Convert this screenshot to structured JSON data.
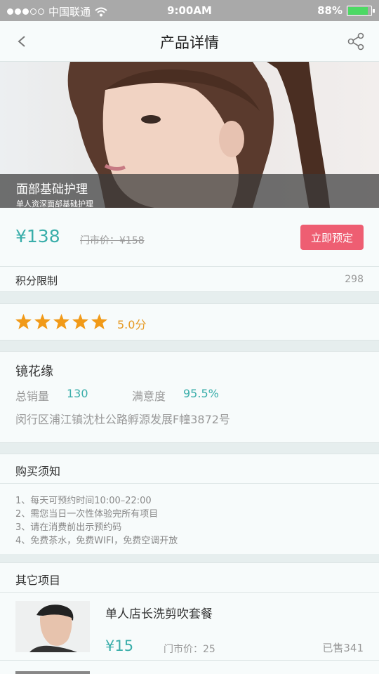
{
  "status": {
    "carrier": "中国联通",
    "time": "9:00AM",
    "battery": "88%",
    "battery_level": 0.88
  },
  "nav": {
    "title": "产品详情",
    "back_icon": "chevron-left-icon",
    "share_icon": "share-icon"
  },
  "hero": {
    "title": "面部基础护理",
    "subtitle": "单人资深面部基础护理"
  },
  "price": {
    "current": "¥138",
    "market": "门市价：¥158",
    "book_label": "立即预定"
  },
  "points": {
    "label": "积分限制",
    "value": "298"
  },
  "rating": {
    "stars": 5,
    "text": "5.0分",
    "star_color": "#f19a18"
  },
  "store": {
    "name": "镜花缘",
    "sales_label": "总销量",
    "sales_value": "130",
    "satisfaction_label": "满意度",
    "satisfaction_value": "95.5%",
    "address": "闵行区浦江镇沈杜公路孵源发展F幢3872号"
  },
  "notice": {
    "title": "购买须知",
    "items": [
      "1、每天可预约时间10:00–22:00",
      "2、需您当日一次性体验完所有项目",
      "3、请在消费前出示预约码",
      "4、免费茶水，免费WIFI，免费空调开放"
    ]
  },
  "others": {
    "title": "其它项目",
    "items": [
      {
        "name": "单人店长洗剪吹套餐",
        "price": "¥15",
        "market": "门市价：25",
        "sold": "已售341"
      }
    ]
  },
  "colors": {
    "accent": "#3aaeaa",
    "button": "#ee5e72"
  }
}
